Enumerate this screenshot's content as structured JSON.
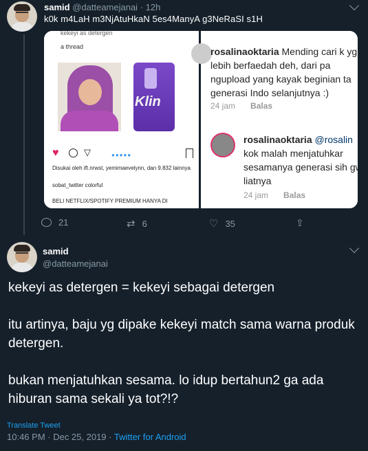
{
  "tweet1": {
    "name": "samid",
    "handle": "@datteamejanai",
    "time": "12h",
    "text": "k0k m4LaH m3NjAtuHkaN 5es4ManyA g3NeRaSI s1H",
    "media": {
      "left_caption_top": "kekeyi as detergen",
      "left_caption": "a thread",
      "product_logo": "Klin",
      "liked_by": "Disukai oleh ift.nrwst, yemimaevelynn, dan 9.832 lainnya",
      "post_user": "sobat_twitter colorful",
      "promo": "BELI NETFLIX/SPOTIFY PREMIUM HANYA DI",
      "comment1": {
        "user": "rosalinaoktaria",
        "text": "Mending cari k yg lebih berfaedah deh, dari pa ngupload yang kayak beginian ta generasi Indo selanjutnya :)",
        "time": "24 jam",
        "reply": "Balas"
      },
      "comment2": {
        "user": "rosalinaoktaria",
        "mention": "@rosalin",
        "text": "kok malah menjatuhkar sesamanya generasi sih gw liatnya",
        "time": "24 jam",
        "reply": "Balas"
      }
    },
    "actions": {
      "replies": "21",
      "retweets": "6",
      "likes": "35"
    }
  },
  "tweet2": {
    "name": "samid",
    "handle": "@datteamejanai",
    "text": "kekeyi as detergen = kekeyi sebagai detergen\n\nitu artinya, baju yg dipake kekeyi match sama warna produk detergen.\n\nbukan menjatuhkan sesama. lo idup bertahun2 ga ada hiburan sama sekali ya tot?!?",
    "translate": "Translate Tweet",
    "timestamp": "10:46 PM · Dec 25, 2019 · ",
    "via": "Twitter for Android"
  },
  "colors": {
    "background": "#15202b",
    "secondary_text": "#8899a6",
    "link": "#1da1f2"
  }
}
